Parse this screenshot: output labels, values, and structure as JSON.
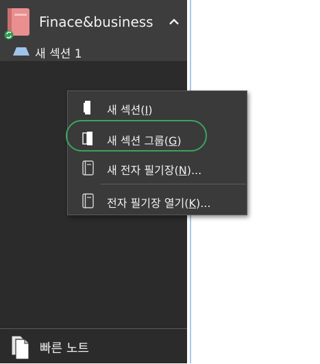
{
  "notebook": {
    "title": "Finace&business",
    "icon": "notebook-icon",
    "sync_icon": "sync-icon",
    "caret_icon": "chevron-up-icon",
    "color": "#e98f8f"
  },
  "sections": [
    {
      "label": "새 섹션 1",
      "icon": "section-tab-icon",
      "color": "#9fc3ea"
    }
  ],
  "context_menu": {
    "items": [
      {
        "label": "새 섹션(",
        "mnemonic": "I",
        "suffix": ")",
        "icon": "section-icon"
      },
      {
        "label": "새 섹션 그룹(",
        "mnemonic": "G",
        "suffix": ")",
        "icon": "section-group-icon"
      },
      {
        "label": "새 전자 필기장(",
        "mnemonic": "N",
        "suffix": ")...",
        "icon": "new-notebook-icon"
      },
      {
        "label": "전자 필기장 열기(",
        "mnemonic": "K",
        "suffix": ")...",
        "icon": "open-notebook-icon"
      }
    ],
    "highlight_color": "#3aa55c"
  },
  "quick_notes": {
    "label": "빠른 노트",
    "icon": "quick-notes-icon"
  }
}
